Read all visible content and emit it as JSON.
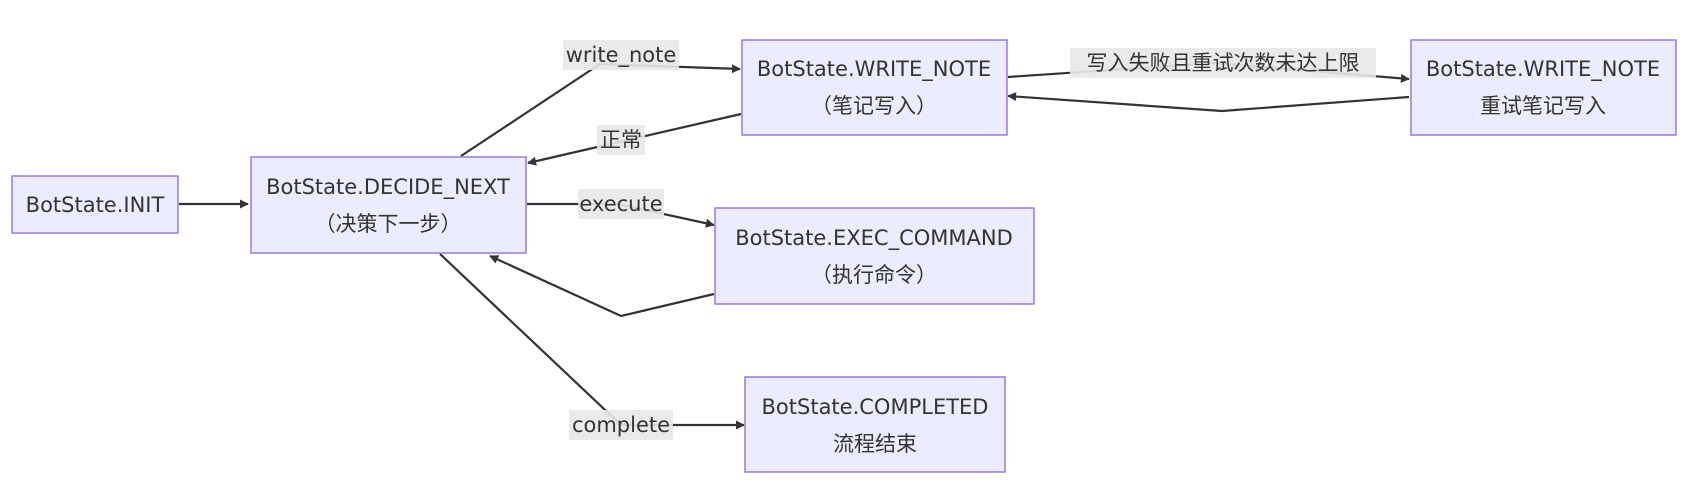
{
  "colors": {
    "node_fill": "#ECECFF",
    "node_border": "#9370DB",
    "edge": "#333333",
    "label_bg": "#e8e8e8",
    "text": "#333333"
  },
  "nodes": {
    "init": {
      "line1": "BotState.INIT"
    },
    "decide_next": {
      "line1": "BotState.DECIDE_NEXT",
      "line2": "（决策下一步）"
    },
    "write_note": {
      "line1": "BotState.WRITE_NOTE",
      "line2": "（笔记写入）"
    },
    "write_note_retry": {
      "line1": "BotState.WRITE_NOTE",
      "line2": "重试笔记写入"
    },
    "exec_command": {
      "line1": "BotState.EXEC_COMMAND",
      "line2": "（执行命令）"
    },
    "completed": {
      "line1": "BotState.COMPLETED",
      "line2": "流程结束"
    }
  },
  "edges": {
    "write_note": "write_note",
    "normal": "正常",
    "retry": "写入失败且重试次数未达上限",
    "execute": "execute",
    "complete": "complete"
  }
}
